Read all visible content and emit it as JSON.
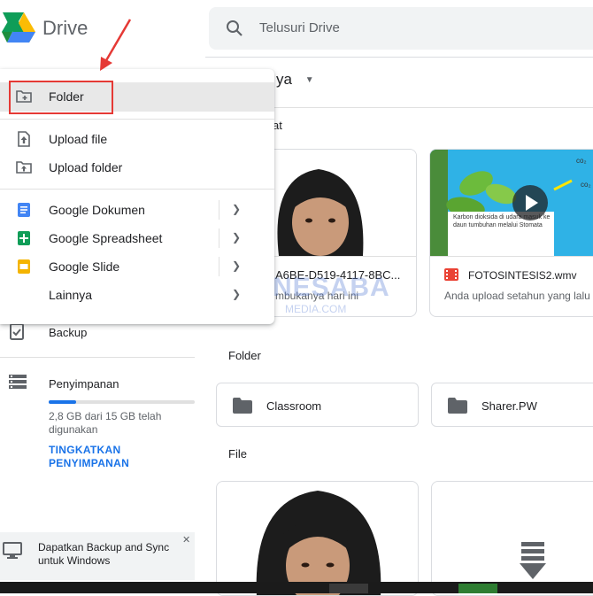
{
  "app": {
    "name": "Drive"
  },
  "search": {
    "placeholder": "Telusuri Drive"
  },
  "main": {
    "breadcrumb_partial": "ya",
    "quick_access_partial": "at",
    "folder_section": "Folder",
    "file_section": "File",
    "quick_cards": [
      {
        "title": "A6BE-D519-4117-8BC...",
        "subtitle": "mbukanya hari ini"
      },
      {
        "title": "FOTOSINTESIS2.wmv",
        "subtitle": "Anda upload setahun yang lalu"
      }
    ],
    "video_caption": "Karbon dioksida di udara masuk ke daun tumbuhan melalui Stomata",
    "folders": [
      {
        "name": "Classroom"
      },
      {
        "name": "Sharer.PW"
      }
    ]
  },
  "sidebar": {
    "backup": "Backup",
    "storage_label": "Penyimpanan",
    "storage_used_text": "2,8 GB dari 15 GB telah digunakan",
    "storage_used_fraction": 0.19,
    "upgrade_label": "TINGKATKAN PENYIMPANAN",
    "promo_text": "Dapatkan Backup and Sync untuk Windows"
  },
  "menu": {
    "folder": "Folder",
    "upload_file": "Upload file",
    "upload_folder": "Upload folder",
    "docs": "Google Dokumen",
    "sheets": "Google Spreadsheet",
    "slides": "Google Slide",
    "more": "Lainnya"
  },
  "watermark": {
    "brand": "NESABA",
    "sub": "MEDIA.COM"
  },
  "colors": {
    "accent": "#1a73e8",
    "highlight_box": "#e53935",
    "docs": "#4285f4",
    "sheets": "#0f9d58",
    "slides": "#f4b400",
    "video_icon": "#ea4335"
  }
}
